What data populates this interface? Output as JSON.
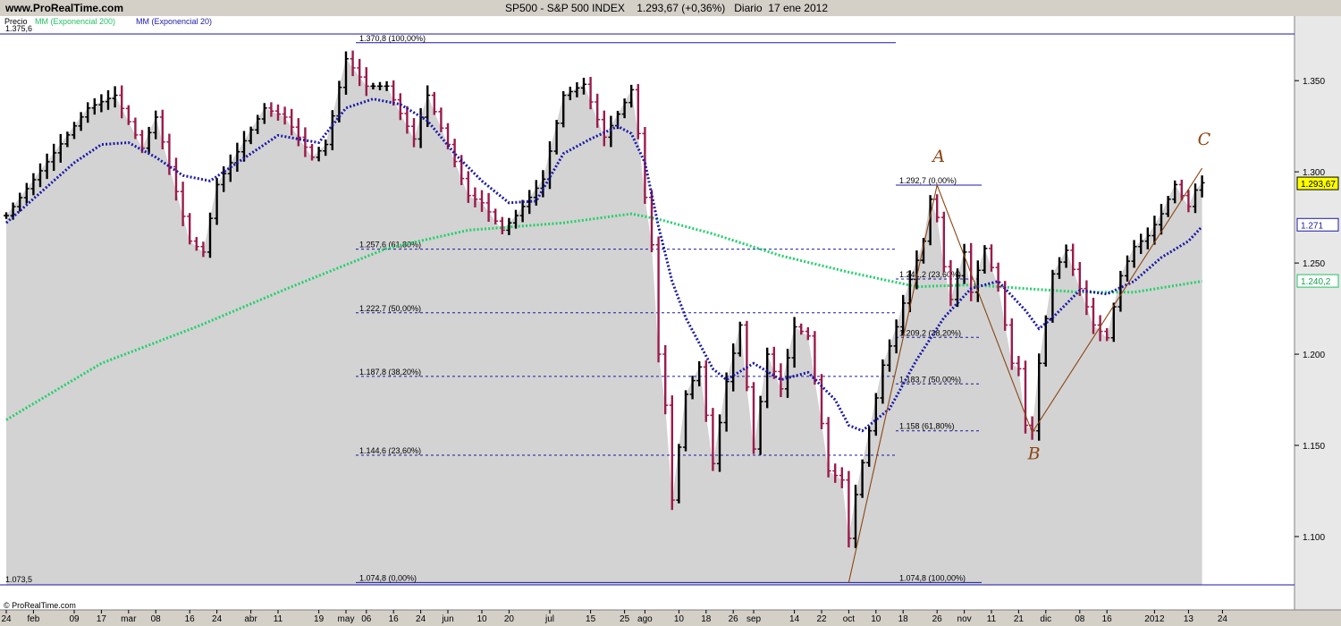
{
  "header": {
    "site": "www.ProRealTime.com",
    "title": "SP500 - S&P 500 INDEX    1.293,67 (+0,36%)   Diario  17 ene 2012"
  },
  "legend": {
    "price": "Precio",
    "ema200": "MM (Exponencial 200)",
    "ema20": "MM (Exponencial 20)"
  },
  "colors": {
    "up": "#000000",
    "down": "#9b1b4b",
    "ema20": "#1a1aa8",
    "ema200": "#22d06a",
    "fill": "#d3d3d3",
    "fib": "#1a1aa8",
    "abc": "#8b4513"
  },
  "chart_data": {
    "type": "ohlc",
    "ylim": [
      1073.5,
      1375.6
    ],
    "y_top_label": "1.375,6",
    "y_bottom_label": "1.073,5",
    "y_ticks": [
      {
        "v": 1350,
        "label": "1.350"
      },
      {
        "v": 1300,
        "label": "1.300"
      },
      {
        "v": 1250,
        "label": "1.250"
      },
      {
        "v": 1200,
        "label": "1.200"
      },
      {
        "v": 1150,
        "label": "1.150"
      },
      {
        "v": 1100,
        "label": "1.100"
      }
    ],
    "x_ticks": [
      {
        "i": 0,
        "label": "24"
      },
      {
        "i": 4,
        "label": "feb"
      },
      {
        "i": 10,
        "label": "09"
      },
      {
        "i": 14,
        "label": "17"
      },
      {
        "i": 18,
        "label": "mar"
      },
      {
        "i": 22,
        "label": "08"
      },
      {
        "i": 27,
        "label": "16"
      },
      {
        "i": 31,
        "label": "24"
      },
      {
        "i": 36,
        "label": "abr"
      },
      {
        "i": 40,
        "label": "11"
      },
      {
        "i": 46,
        "label": "19"
      },
      {
        "i": 50,
        "label": "may"
      },
      {
        "i": 53,
        "label": "06"
      },
      {
        "i": 57,
        "label": "16"
      },
      {
        "i": 61,
        "label": "24"
      },
      {
        "i": 65,
        "label": "jun"
      },
      {
        "i": 70,
        "label": "10"
      },
      {
        "i": 74,
        "label": "20"
      },
      {
        "i": 80,
        "label": "jul"
      },
      {
        "i": 86,
        "label": "15"
      },
      {
        "i": 91,
        "label": "25"
      },
      {
        "i": 94,
        "label": "ago"
      },
      {
        "i": 99,
        "label": "10"
      },
      {
        "i": 103,
        "label": "18"
      },
      {
        "i": 107,
        "label": "26"
      },
      {
        "i": 110,
        "label": "sep"
      },
      {
        "i": 116,
        "label": "14"
      },
      {
        "i": 120,
        "label": "22"
      },
      {
        "i": 124,
        "label": "oct"
      },
      {
        "i": 128,
        "label": "10"
      },
      {
        "i": 132,
        "label": "18"
      },
      {
        "i": 137,
        "label": "26"
      },
      {
        "i": 141,
        "label": "nov"
      },
      {
        "i": 145,
        "label": "11"
      },
      {
        "i": 149,
        "label": "21"
      },
      {
        "i": 153,
        "label": "dic"
      },
      {
        "i": 158,
        "label": "08"
      },
      {
        "i": 162,
        "label": "16"
      },
      {
        "i": 169,
        "label": "2012"
      },
      {
        "i": 174,
        "label": "13"
      },
      {
        "i": 179,
        "label": "24"
      }
    ],
    "price_key": [
      [
        0,
        1276
      ],
      [
        12,
        1335
      ],
      [
        16,
        1342
      ],
      [
        20,
        1313
      ],
      [
        22,
        1330
      ],
      [
        27,
        1262
      ],
      [
        29,
        1256
      ],
      [
        31,
        1293
      ],
      [
        38,
        1335
      ],
      [
        41,
        1330
      ],
      [
        45,
        1308
      ],
      [
        47,
        1315
      ],
      [
        50,
        1362
      ],
      [
        53,
        1347
      ],
      [
        56,
        1347
      ],
      [
        58,
        1332
      ],
      [
        60,
        1318
      ],
      [
        62,
        1342
      ],
      [
        65,
        1315
      ],
      [
        68,
        1287
      ],
      [
        70,
        1283
      ],
      [
        73,
        1268
      ],
      [
        75,
        1276
      ],
      [
        77,
        1286
      ],
      [
        79,
        1296
      ],
      [
        82,
        1342
      ],
      [
        85,
        1348
      ],
      [
        88,
        1319
      ],
      [
        91,
        1338
      ],
      [
        92,
        1345
      ],
      [
        93,
        1321
      ],
      [
        94,
        1286
      ],
      [
        95,
        1260
      ],
      [
        96,
        1200
      ],
      [
        97,
        1172
      ],
      [
        98,
        1120
      ],
      [
        100,
        1178
      ],
      [
        102,
        1193
      ],
      [
        104,
        1140
      ],
      [
        106,
        1185
      ],
      [
        108,
        1216
      ],
      [
        110,
        1148
      ],
      [
        112,
        1200
      ],
      [
        114,
        1181
      ],
      [
        116,
        1215
      ],
      [
        118,
        1210
      ],
      [
        120,
        1162
      ],
      [
        121,
        1136
      ],
      [
        123,
        1131
      ],
      [
        124,
        1099
      ],
      [
        125,
        1123
      ],
      [
        127,
        1158
      ],
      [
        129,
        1194
      ],
      [
        131,
        1215
      ],
      [
        133,
        1241
      ],
      [
        135,
        1262
      ],
      [
        136,
        1285
      ],
      [
        137,
        1275
      ],
      [
        138,
        1248
      ],
      [
        139,
        1230
      ],
      [
        141,
        1256
      ],
      [
        142,
        1234
      ],
      [
        144,
        1258
      ],
      [
        146,
        1237
      ],
      [
        148,
        1195
      ],
      [
        149,
        1192
      ],
      [
        150,
        1161
      ],
      [
        151,
        1158
      ],
      [
        152,
        1195
      ],
      [
        154,
        1244
      ],
      [
        156,
        1257
      ],
      [
        158,
        1236
      ],
      [
        160,
        1216
      ],
      [
        162,
        1209
      ],
      [
        164,
        1243
      ],
      [
        166,
        1259
      ],
      [
        168,
        1265
      ],
      [
        170,
        1277
      ],
      [
        172,
        1293
      ],
      [
        174,
        1281
      ],
      [
        175,
        1290
      ],
      [
        176,
        1294
      ]
    ],
    "ema20_key": [
      [
        0,
        1272
      ],
      [
        10,
        1305
      ],
      [
        14,
        1315
      ],
      [
        18,
        1316
      ],
      [
        22,
        1308
      ],
      [
        26,
        1298
      ],
      [
        30,
        1295
      ],
      [
        34,
        1305
      ],
      [
        40,
        1320
      ],
      [
        46,
        1316
      ],
      [
        50,
        1335
      ],
      [
        54,
        1340
      ],
      [
        58,
        1337
      ],
      [
        62,
        1328
      ],
      [
        66,
        1310
      ],
      [
        70,
        1295
      ],
      [
        74,
        1283
      ],
      [
        78,
        1284
      ],
      [
        82,
        1310
      ],
      [
        86,
        1318
      ],
      [
        90,
        1325
      ],
      [
        92,
        1321
      ],
      [
        94,
        1305
      ],
      [
        96,
        1270
      ],
      [
        98,
        1240
      ],
      [
        100,
        1220
      ],
      [
        104,
        1192
      ],
      [
        106,
        1186
      ],
      [
        110,
        1195
      ],
      [
        114,
        1186
      ],
      [
        118,
        1190
      ],
      [
        122,
        1175
      ],
      [
        124,
        1161
      ],
      [
        126,
        1158
      ],
      [
        130,
        1170
      ],
      [
        134,
        1197
      ],
      [
        138,
        1220
      ],
      [
        142,
        1236
      ],
      [
        146,
        1240
      ],
      [
        150,
        1224
      ],
      [
        152,
        1214
      ],
      [
        154,
        1220
      ],
      [
        158,
        1235
      ],
      [
        162,
        1233
      ],
      [
        166,
        1240
      ],
      [
        170,
        1253
      ],
      [
        174,
        1262
      ],
      [
        176,
        1270
      ]
    ],
    "ema200_key": [
      [
        0,
        1164
      ],
      [
        14,
        1195
      ],
      [
        28,
        1215
      ],
      [
        42,
        1237
      ],
      [
        56,
        1258
      ],
      [
        68,
        1268
      ],
      [
        82,
        1272
      ],
      [
        92,
        1277
      ],
      [
        96,
        1274
      ],
      [
        104,
        1266
      ],
      [
        114,
        1254
      ],
      [
        124,
        1245
      ],
      [
        134,
        1237
      ],
      [
        142,
        1238
      ],
      [
        150,
        1236
      ],
      [
        158,
        1234
      ],
      [
        166,
        1234
      ],
      [
        176,
        1240
      ]
    ],
    "fib_left": {
      "x_start": 398,
      "x_end": 1002,
      "levels": [
        {
          "v": 1370.8,
          "label": "1.370,8 (100,00%)",
          "solid": true
        },
        {
          "v": 1257.6,
          "label": "1.257,6 (61,80%)",
          "solid": false
        },
        {
          "v": 1222.7,
          "label": "1.222,7 (50,00%)",
          "solid": false
        },
        {
          "v": 1187.8,
          "label": "1.187,8 (38,20%)",
          "solid": false
        },
        {
          "v": 1144.6,
          "label": "1.144,6 (23,60%)",
          "solid": false
        },
        {
          "v": 1074.8,
          "label": "1.074,8 (0,00%)",
          "solid": true
        }
      ]
    },
    "fib_right": {
      "x_start": 1002,
      "x_end": 1098,
      "levels": [
        {
          "v": 1292.7,
          "label": "1.292,7 (0,00%)",
          "solid": true
        },
        {
          "v": 1241.2,
          "label": "1.241,2 (23,60%)",
          "solid": false
        },
        {
          "v": 1209.2,
          "label": "1.209,2 (38,20%)",
          "solid": false
        },
        {
          "v": 1183.7,
          "label": "1.183,7 (50,00%)",
          "solid": false
        },
        {
          "v": 1158,
          "label": "1.158 (61,80%)",
          "solid": false
        },
        {
          "v": 1074.8,
          "label": "1.074,8 (100,00%)",
          "solid": true
        }
      ]
    },
    "wave_labels": [
      {
        "label": "A",
        "i": 137,
        "v": 1292.7
      },
      {
        "label": "B",
        "i": 151,
        "v": 1157
      },
      {
        "label": "C",
        "i": 176,
        "v": 1302
      }
    ],
    "last_values": [
      {
        "v": 1293.67,
        "label": "1.293,67",
        "kind": "price"
      },
      {
        "v": 1271,
        "label": "1.271",
        "kind": "ema20"
      },
      {
        "v": 1240.2,
        "label": "1.240,2",
        "kind": "ema200"
      }
    ]
  },
  "footer": {
    "copyright": "© ProRealTime.com"
  }
}
